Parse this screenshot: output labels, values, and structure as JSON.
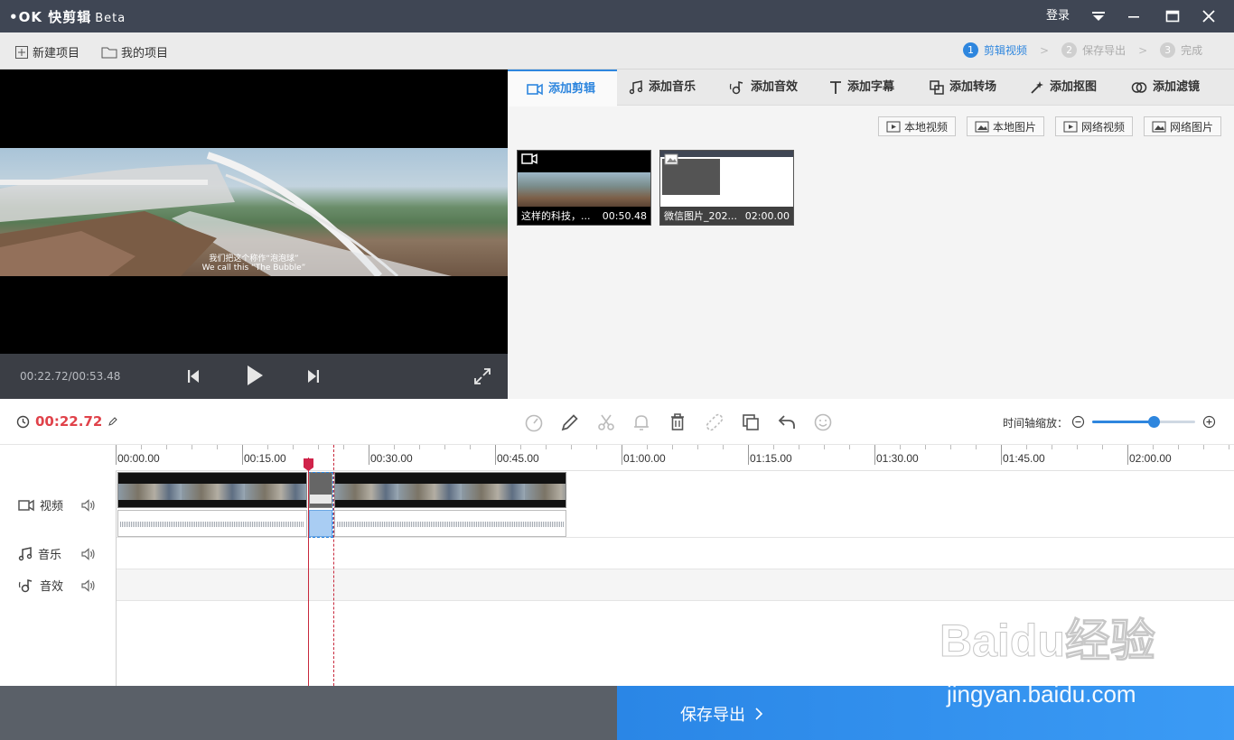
{
  "app": {
    "name": "快剪辑",
    "badge": "Beta"
  },
  "titlebar": {
    "login": "登录"
  },
  "menubar": {
    "new_project": "新建项目",
    "my_projects": "我的项目",
    "steps": [
      {
        "num": "1",
        "label": "剪辑视频",
        "active": true
      },
      {
        "num": "2",
        "label": "保存导出",
        "active": false
      },
      {
        "num": "3",
        "label": "完成",
        "active": false
      }
    ]
  },
  "preview": {
    "subtitle_cn": "我们把这个称作“泡泡球”",
    "subtitle_en": "We call this “The Bubble”",
    "time": "00:22.72/00:53.48"
  },
  "tabs": [
    "添加剪辑",
    "添加音乐",
    "添加音效",
    "添加字幕",
    "添加转场",
    "添加抠图",
    "添加滤镜"
  ],
  "source_buttons": [
    "本地视频",
    "本地图片",
    "网络视频",
    "网络图片"
  ],
  "media": [
    {
      "name": "这样的科技，...",
      "duration": "00:50.48",
      "icon": "video-icon"
    },
    {
      "name": "微信图片_202...",
      "duration": "02:00.00",
      "icon": "image-icon"
    }
  ],
  "timeline": {
    "current_time": "00:22.72",
    "zoom_label": "时间轴缩放：",
    "zoom_level": 0.6,
    "ruler": [
      "00:00.00",
      "00:15.00",
      "00:30.00",
      "00:45.00",
      "01:00.00",
      "01:15.00",
      "01:30.00",
      "01:45.00",
      "02:00.00"
    ],
    "tracks": {
      "video": "视频",
      "music": "音乐",
      "sfx": "音效"
    }
  },
  "bottom": {
    "export": "保存导出"
  },
  "watermark": {
    "brand": "Bai",
    "brand2": "du",
    "cn": "经验",
    "url": "jingyan.baidu.com"
  }
}
